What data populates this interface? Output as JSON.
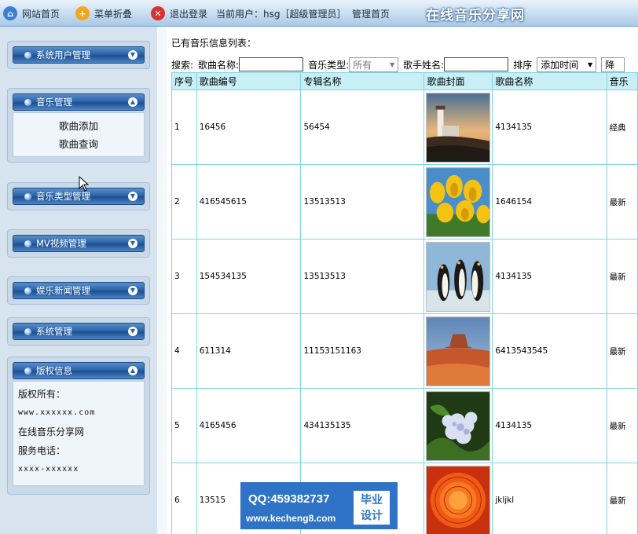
{
  "topbar": {
    "items": [
      {
        "label": "网站首页",
        "icon": "home-icon",
        "color": "#3a7fd0"
      },
      {
        "label": "菜单折叠",
        "icon": "plus-icon",
        "color": "#f2a51f"
      },
      {
        "label": "退出登录",
        "icon": "close-icon",
        "color": "#d93030"
      }
    ],
    "user_text": "当前用户：hsg［超级管理员］",
    "admin_home": "管理首页",
    "site_title": "在线音乐分享网"
  },
  "sidebar": {
    "panels": [
      {
        "title": "系统用户管理",
        "expanded": false
      },
      {
        "title": "音乐管理",
        "expanded": true,
        "items": [
          "歌曲添加",
          "歌曲查询"
        ]
      },
      {
        "title": "音乐类型管理",
        "expanded": false
      },
      {
        "title": "MV视频管理",
        "expanded": false
      },
      {
        "title": "娱乐新闻管理",
        "expanded": false
      },
      {
        "title": "系统管理",
        "expanded": false
      },
      {
        "title": "版权信息",
        "expanded": true,
        "lines": [
          "版权所有：",
          "www.xxxxxx.com",
          "在线音乐分享网",
          "服务电话：",
          "xxxx-xxxxxx"
        ]
      }
    ]
  },
  "content": {
    "list_title": "已有音乐信息列表：",
    "search": {
      "label": "搜索:",
      "song_name_label": "歌曲名称:",
      "song_name_value": "",
      "type_label": "音乐类型:",
      "type_value": "所有",
      "singer_label": "歌手姓名:",
      "singer_value": "",
      "sort_label": "排序",
      "sort_value": "添加时间",
      "order_value": "降"
    },
    "columns": [
      "序号",
      "歌曲编号",
      "专辑名称",
      "歌曲封面",
      "歌曲名称",
      "音乐"
    ],
    "rows": [
      {
        "index": "1",
        "song_no": "16456",
        "album": "56454",
        "cover": "lighthouse-image",
        "name": "4134135",
        "type": "经典"
      },
      {
        "index": "2",
        "song_no": "416545615",
        "album": "13513513",
        "cover": "tulips-image",
        "name": "1646154",
        "type": "最新"
      },
      {
        "index": "3",
        "song_no": "154534135",
        "album": "13513513",
        "cover": "penguins-image",
        "name": "4134135",
        "type": "最新"
      },
      {
        "index": "4",
        "song_no": "611314",
        "album": "11153151163",
        "cover": "desert-image",
        "name": "6413543545",
        "type": "最新"
      },
      {
        "index": "5",
        "song_no": "4165456",
        "album": "434135135",
        "cover": "hydrangea-image",
        "name": "4134135",
        "type": "最新"
      },
      {
        "index": "6",
        "song_no": "13515",
        "album": "",
        "cover": "chrysanthemum-image",
        "name": "jkljkl",
        "type": "最新"
      }
    ]
  },
  "watermark": {
    "qq": "QQ:459382737",
    "url": "www.kecheng8.com",
    "badge_line1": "毕业",
    "badge_line2": "设计"
  }
}
